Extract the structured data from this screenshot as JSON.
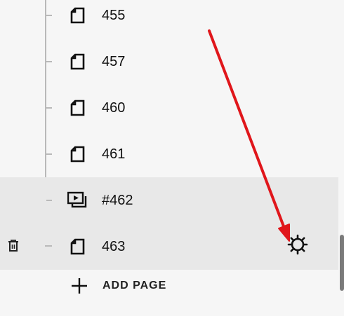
{
  "pages": [
    {
      "label": "455",
      "icon": "page-icon",
      "highlighted": false
    },
    {
      "label": "457",
      "icon": "page-icon",
      "highlighted": false
    },
    {
      "label": "460",
      "icon": "page-icon",
      "highlighted": false
    },
    {
      "label": "461",
      "icon": "page-icon",
      "highlighted": false
    },
    {
      "label": "#462",
      "icon": "media-page-icon",
      "highlighted": true
    },
    {
      "label": "463",
      "icon": "page-icon",
      "highlighted": true
    }
  ],
  "add_page": {
    "label": "ADD PAGE",
    "icon": "plus-icon"
  },
  "row_actions": {
    "delete_icon": "trash-icon",
    "settings_icon": "gear-icon"
  },
  "colors": {
    "background": "#f6f6f6",
    "highlight": "#e8e8e8",
    "tree_line": "#b9b9b9",
    "annotation_arrow": "#e0161b"
  }
}
